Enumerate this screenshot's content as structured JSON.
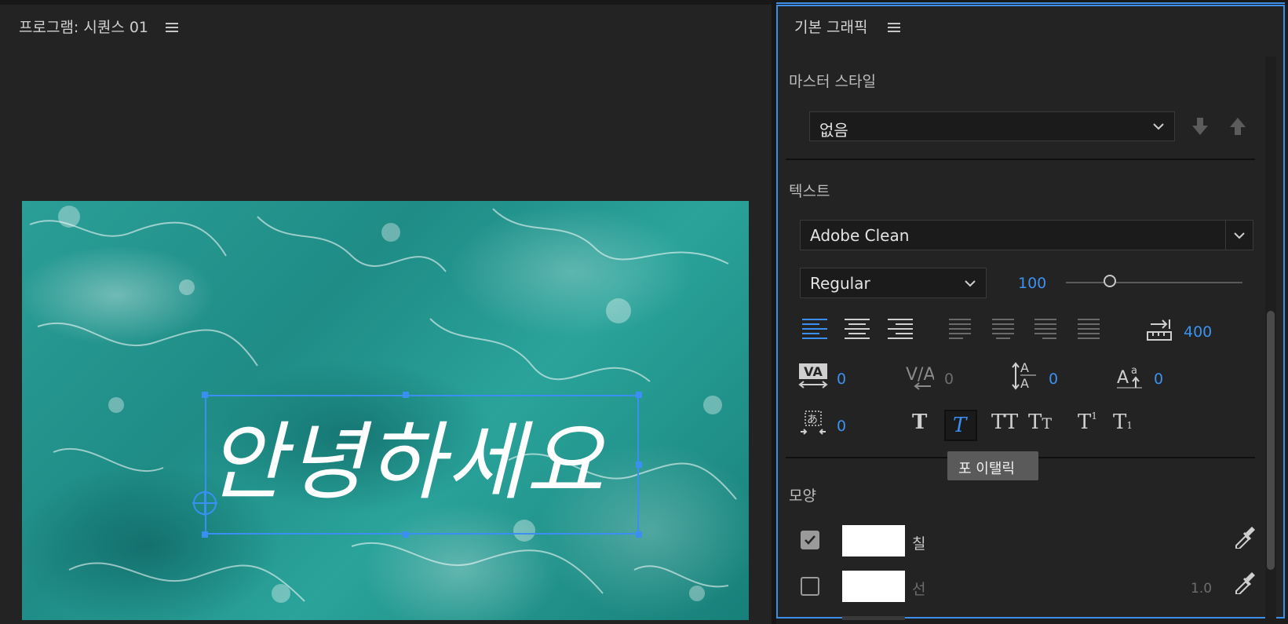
{
  "program": {
    "title": "프로그램: 시퀀스 01",
    "menu_icon": "hamburger-icon",
    "title_text": "안녕하세요"
  },
  "graphics": {
    "title": "기본 그래픽",
    "menu_icon": "hamburger-icon",
    "master_style": {
      "label": "마스터 스타일",
      "value": "없음"
    },
    "text_section": {
      "label": "텍스트",
      "font": "Adobe Clean",
      "style": "Regular",
      "size": "100",
      "size_slider_fraction": 0.25,
      "tab_value": "400",
      "tracking": "0",
      "kerning": "0",
      "leading": "0",
      "baseline_shift": "0",
      "tsume": "0"
    },
    "tooltip": "포 이탤릭",
    "appearance": {
      "label": "모양",
      "fill_label": "칠",
      "fill_checked": true,
      "fill_color": "#ffffff",
      "stroke_label": "선",
      "stroke_checked": false,
      "stroke_color": "#ffffff",
      "stroke_width": "1.0"
    }
  },
  "colors": {
    "accent": "#3b8ff2",
    "panel_bg": "#232323"
  }
}
